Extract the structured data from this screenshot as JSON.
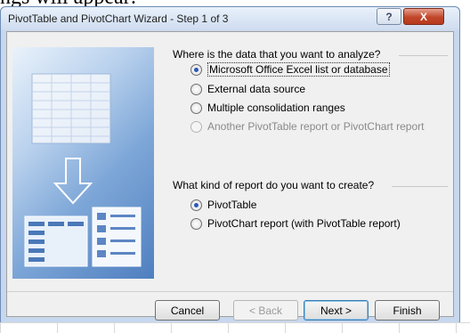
{
  "background": {
    "document_text": "ngs will appear:",
    "highlighted": ""
  },
  "dialog": {
    "title": "PivotTable and PivotChart Wizard - Step 1 of 3",
    "help_label": "?",
    "close_label": "X"
  },
  "data_source": {
    "prompt": "Where is the data that you want to analyze?",
    "options": [
      {
        "label": "Microsoft Office Excel list or database",
        "checked": true,
        "disabled": false
      },
      {
        "label": "External data source",
        "checked": false,
        "disabled": false
      },
      {
        "label": "Multiple consolidation ranges",
        "checked": false,
        "disabled": false
      },
      {
        "label": "Another PivotTable report or PivotChart report",
        "checked": false,
        "disabled": true
      }
    ]
  },
  "report_kind": {
    "prompt": "What kind of report do you want to create?",
    "options": [
      {
        "label": "PivotTable",
        "checked": true,
        "disabled": false
      },
      {
        "label": "PivotChart report (with PivotTable report)",
        "checked": false,
        "disabled": false
      }
    ]
  },
  "buttons": {
    "cancel": "Cancel",
    "back": "< Back",
    "next": "Next >",
    "finish": "Finish"
  }
}
